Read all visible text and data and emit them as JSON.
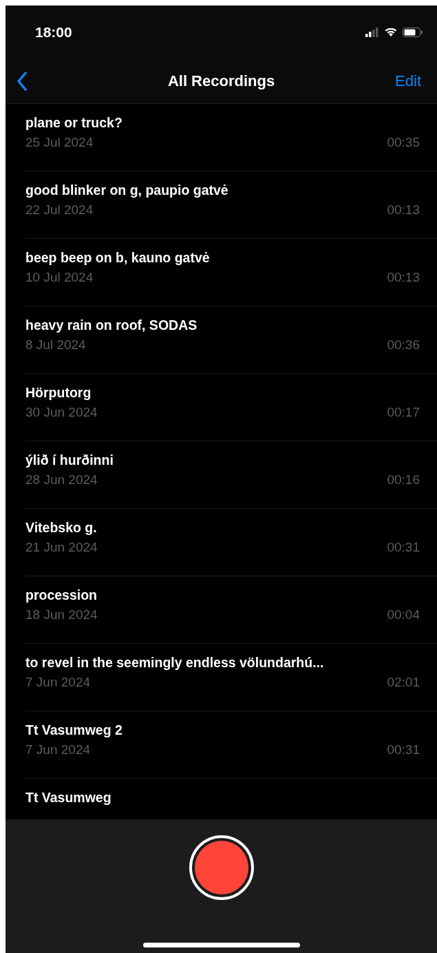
{
  "status_bar": {
    "time": "18:00"
  },
  "nav": {
    "title": "All Recordings",
    "action": "Edit"
  },
  "recordings": [
    {
      "title": "plane or truck?",
      "date": "25 Jul 2024",
      "duration": "00:35"
    },
    {
      "title": "good blinker on g, paupio gatvė",
      "date": "22 Jul 2024",
      "duration": "00:13"
    },
    {
      "title": "beep beep on b, kauno gatvė",
      "date": "10 Jul 2024",
      "duration": "00:13"
    },
    {
      "title": "heavy rain on roof, SODAS",
      "date": "8 Jul 2024",
      "duration": "00:36"
    },
    {
      "title": "Hörputorg",
      "date": "30 Jun 2024",
      "duration": "00:17"
    },
    {
      "title": "ýlið í hurðinni",
      "date": "28 Jun 2024",
      "duration": "00:16"
    },
    {
      "title": "Vitebsko g.",
      "date": "21 Jun 2024",
      "duration": "00:31"
    },
    {
      "title": "procession",
      "date": "18 Jun 2024",
      "duration": "00:04"
    },
    {
      "title": "to revel in the seemingly endless völundarhú...",
      "date": "7 Jun 2024",
      "duration": "02:01"
    },
    {
      "title": "Tt Vasumweg 2",
      "date": "7 Jun 2024",
      "duration": "00:31"
    },
    {
      "title": "Tt Vasumweg"
    }
  ]
}
